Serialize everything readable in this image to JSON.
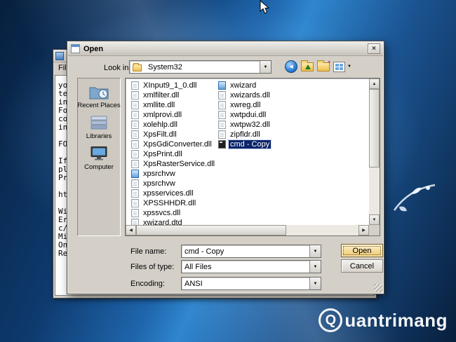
{
  "icons": {
    "close": "×",
    "dropdown": "▼",
    "scroll_up": "▲",
    "scroll_down": "▼",
    "scroll_left": "◀",
    "scroll_right": "▶",
    "back": "◀",
    "new_folder_spark": "*"
  },
  "colors": {
    "selection": "#0a246a",
    "dialog_bg": "#d4d0c8",
    "desktop_blue": "#1f66ad"
  },
  "notepad": {
    "menu_file": "File",
    "lines": [
      "you",
      "tec",
      "inf",
      "For",
      "com",
      "in",
      "",
      "FOR",
      "",
      "If",
      "ple",
      "Pri",
      "",
      "htt",
      "",
      "Wir",
      "Err",
      "c/o",
      "Mic",
      "One",
      "Rec"
    ]
  },
  "dialog": {
    "title": "Open",
    "look_in_label": "Look in:",
    "look_in_value": "System32",
    "places": [
      {
        "label": "Recent Places"
      },
      {
        "label": "Libraries"
      },
      {
        "label": "Computer"
      }
    ],
    "files_col1": [
      {
        "name": "XInput9_1_0.dll",
        "icon": "doc"
      },
      {
        "name": "xmlfilter.dll",
        "icon": "doc"
      },
      {
        "name": "xmllite.dll",
        "icon": "doc"
      },
      {
        "name": "xmlprovi.dll",
        "icon": "doc"
      },
      {
        "name": "xolehlp.dll",
        "icon": "doc"
      },
      {
        "name": "XpsFilt.dll",
        "icon": "doc"
      },
      {
        "name": "XpsGdiConverter.dll",
        "icon": "doc"
      },
      {
        "name": "XpsPrint.dll",
        "icon": "doc"
      },
      {
        "name": "XpsRasterService.dll",
        "icon": "doc"
      },
      {
        "name": "xpsrchvw",
        "icon": "app"
      },
      {
        "name": "xpsrchvw",
        "icon": "doc"
      },
      {
        "name": "xpsservices.dll",
        "icon": "doc"
      },
      {
        "name": "XPSSHHDR.dll",
        "icon": "doc"
      },
      {
        "name": "xpssvcs.dll",
        "icon": "doc"
      },
      {
        "name": "xwizard.dtd",
        "icon": "doc"
      }
    ],
    "files_col2": [
      {
        "name": "xwizard",
        "icon": "app"
      },
      {
        "name": "xwizards.dll",
        "icon": "doc"
      },
      {
        "name": "xwreg.dll",
        "icon": "doc"
      },
      {
        "name": "xwtpdui.dll",
        "icon": "doc"
      },
      {
        "name": "xwtpw32.dll",
        "icon": "doc"
      },
      {
        "name": "zipfldr.dll",
        "icon": "doc"
      },
      {
        "name": "cmd - Copy",
        "icon": "cmd",
        "selected": "true"
      }
    ],
    "file_name_label": "File name:",
    "file_name_value": "cmd - Copy",
    "files_of_type_label": "Files of type:",
    "files_of_type_value": "All Files",
    "encoding_label": "Encoding:",
    "encoding_value": "ANSI",
    "open_button": "Open",
    "cancel_button": "Cancel"
  },
  "watermark": {
    "initial": "Q",
    "rest": "uantrimang"
  }
}
